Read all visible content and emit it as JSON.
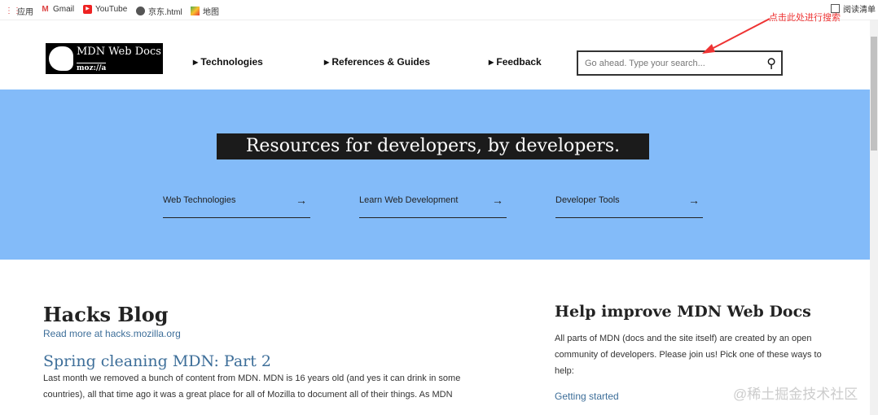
{
  "bookmarks": {
    "items": [
      {
        "label": "应用",
        "icon": "apps-icon"
      },
      {
        "label": "Gmail",
        "icon": "gmail-icon"
      },
      {
        "label": "YouTube",
        "icon": "youtube-icon"
      },
      {
        "label": "京东.html",
        "icon": "globe-icon"
      },
      {
        "label": "地图",
        "icon": "maps-icon"
      }
    ],
    "reading_list": "阅读清单"
  },
  "header": {
    "logo_title": "MDN Web Docs",
    "logo_sub": "moz://a",
    "nav": [
      "Technologies",
      "References & Guides",
      "Feedback"
    ],
    "search_placeholder": "Go ahead. Type your search...",
    "annotation": "点击此处进行搜索"
  },
  "hero": {
    "title": "Resources for developers, by developers.",
    "links": [
      "Web Technologies",
      "Learn Web Development",
      "Developer Tools"
    ]
  },
  "blog": {
    "title": "Hacks Blog",
    "read_more": "Read more at hacks.mozilla.org",
    "post_title": "Spring cleaning MDN: Part 2",
    "post_text": "Last month we removed a bunch of content from MDN. MDN is 16 years old (and yes it can drink in some countries), all that time ago it was a great place for all of Mozilla to document all of their things. As MDN"
  },
  "help": {
    "title": "Help improve MDN Web Docs",
    "text": "All parts of MDN (docs and the site itself) are created by an open community of developers. Please join us! Pick one of these ways to help:",
    "link": "Getting started"
  },
  "watermark": "@稀土掘金技术社区"
}
